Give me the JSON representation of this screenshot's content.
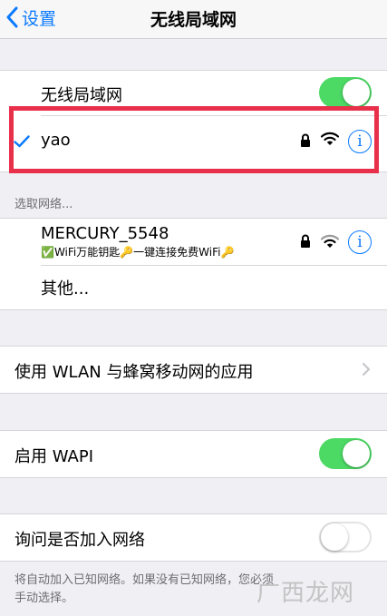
{
  "nav": {
    "back_label": "设置",
    "title": "无线局域网"
  },
  "wlan": {
    "label": "无线局域网",
    "toggle_on": true
  },
  "connected": {
    "ssid": "yao",
    "secured": true,
    "icons": [
      "checkmark-icon",
      "lock-icon",
      "wifi-icon",
      "info-icon"
    ]
  },
  "choose_network": {
    "header": "选取网络..."
  },
  "networks": [
    {
      "ssid": "MERCURY_5548",
      "subtitle": "✅WiFi万能钥匙🔑一键连接免费WiFi🔑",
      "secured": true
    },
    {
      "ssid": "其他..."
    }
  ],
  "apps_row": {
    "label": "使用 WLAN 与蜂窝移动网的应用"
  },
  "wapi": {
    "label": "启用 WAPI",
    "toggle_on": true
  },
  "ask_join": {
    "label": "询问是否加入网络",
    "toggle_on": false
  },
  "footer": {
    "line1": "将自动加入已知网络。如果没有已知网络，您必须",
    "line2": "手动选择。"
  },
  "watermark": {
    "text": "广西龙网"
  },
  "colors": {
    "accent": "#0a7aff",
    "toggle_on": "#4cd964",
    "highlight": "#e8304b",
    "background": "#efeff4"
  }
}
